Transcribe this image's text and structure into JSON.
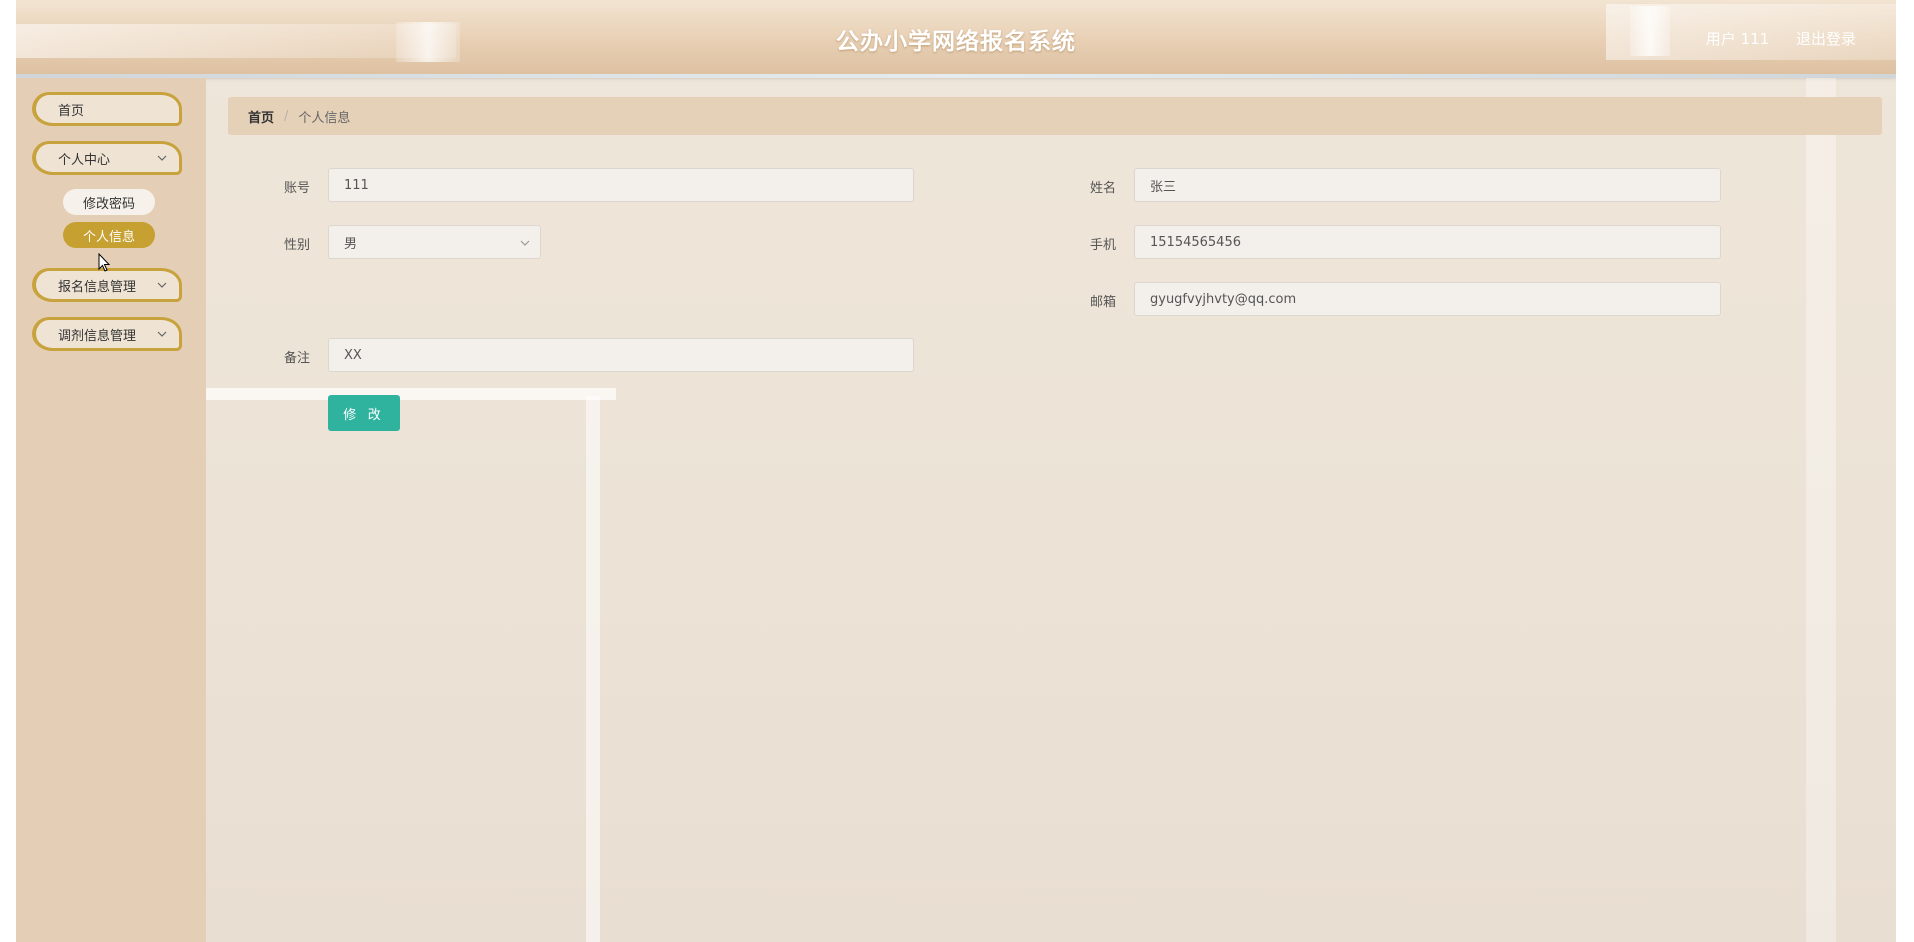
{
  "header": {
    "title": "公办小学网络报名系统",
    "user_label": "用户 111",
    "logout_label": "退出登录"
  },
  "sidebar": {
    "items": [
      {
        "label": "首页",
        "has_chevron": false
      },
      {
        "label": "个人中心",
        "has_chevron": true,
        "expanded": true,
        "children": [
          {
            "label": "修改密码",
            "active": false
          },
          {
            "label": "个人信息",
            "active": true
          }
        ]
      },
      {
        "label": "报名信息管理",
        "has_chevron": true
      },
      {
        "label": "调剂信息管理",
        "has_chevron": true
      }
    ]
  },
  "breadcrumb": {
    "home": "首页",
    "separator": "/",
    "current": "个人信息"
  },
  "form": {
    "account": {
      "label": "账号",
      "value": "111"
    },
    "name": {
      "label": "姓名",
      "value": "张三"
    },
    "gender": {
      "label": "性别",
      "value": "男"
    },
    "phone": {
      "label": "手机",
      "value": "15154565456"
    },
    "email": {
      "label": "邮箱",
      "value": "gyugfvyjhvty@qq.com"
    },
    "remark": {
      "label": "备注",
      "value": "XX"
    },
    "submit_label": "修 改"
  },
  "colors": {
    "accent_gold": "#c6a030",
    "submit_button": "#2fb39e",
    "sidebar_bg": "#e4cfb6",
    "breadcrumb_bg": "#e5d1b8"
  },
  "icons": [
    "chevron-down-icon",
    "cursor-icon"
  ]
}
